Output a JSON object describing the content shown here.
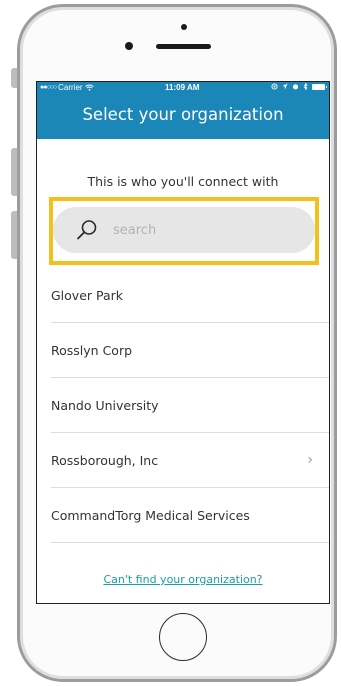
{
  "status_bar": {
    "carrier": "Carrier",
    "time": "11:09 AM"
  },
  "header": {
    "title": "Select your organization"
  },
  "subtitle": "This is who you'll connect with",
  "search": {
    "placeholder": "search",
    "value": ""
  },
  "organizations": [
    {
      "name": "Glover Park",
      "has_chevron": false
    },
    {
      "name": "Rosslyn Corp",
      "has_chevron": false
    },
    {
      "name": "Nando University",
      "has_chevron": false
    },
    {
      "name": "Rossborough, Inc",
      "has_chevron": true
    },
    {
      "name": "CommandTorg Medical Services",
      "has_chevron": false
    }
  ],
  "chevron_glyph": "›",
  "footer_link": "Can't find your organization?",
  "colors": {
    "header_bg": "#1b86b8",
    "highlight": "#f3c01d",
    "link": "#1a9da6"
  }
}
